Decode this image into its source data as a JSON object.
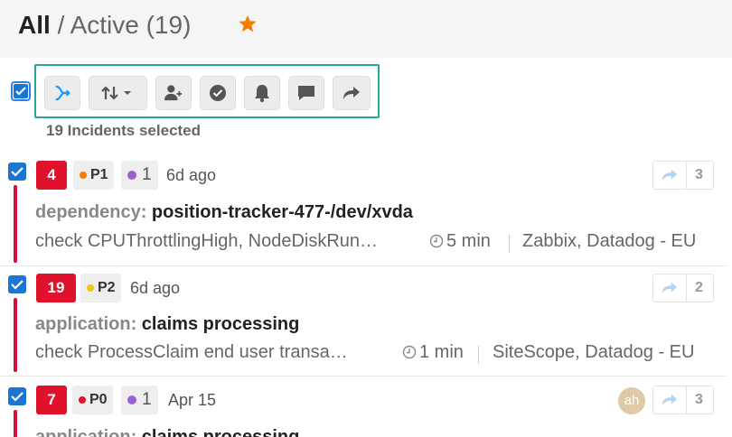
{
  "header": {
    "title_all": "All",
    "title_separator": "/",
    "title_active": "Active (19)",
    "star_icon": "star-icon",
    "star_color": "#f57c00"
  },
  "toolbar": {
    "selected_text": "19 Incidents selected",
    "buttons": [
      "merge-icon",
      "sort-icon",
      "assign-user-icon",
      "resolve-icon",
      "notify-icon",
      "comment-icon",
      "forward-icon"
    ]
  },
  "incidents": [
    {
      "count": "4",
      "priority": "P1",
      "priority_color": "#f57c00",
      "alerts": "1",
      "alerts_color": "#9c5fd6",
      "ago": "6d ago",
      "category": "dependency:",
      "name": "position-tracker-477-/dev/xvda",
      "check_label": "check",
      "check_text": "CPUThrottlingHigh, NodeDiskRun…",
      "duration": "5 min",
      "sources": "Zabbix, Datadog - EU",
      "forward_count": "3"
    },
    {
      "count": "19",
      "priority": "P2",
      "priority_color": "#f2c417",
      "ago": "6d ago",
      "category": "application:",
      "name": "claims processing",
      "check_label": "check",
      "check_text": "ProcessClaim end user transa…",
      "duration": "1 min",
      "sources": "SiteScope, Datadog - EU",
      "forward_count": "2"
    },
    {
      "count": "7",
      "priority": "P0",
      "priority_color": "#e0112b",
      "alerts": "1",
      "alerts_color": "#9c5fd6",
      "ago": "Apr 15",
      "avatar": "ah",
      "category": "application:",
      "name": "claims processing",
      "forward_count": "3"
    }
  ],
  "colors": {
    "accent": "#1976d2",
    "toolbar_border": "#26a69a",
    "incident_bar": "#d0103a"
  }
}
